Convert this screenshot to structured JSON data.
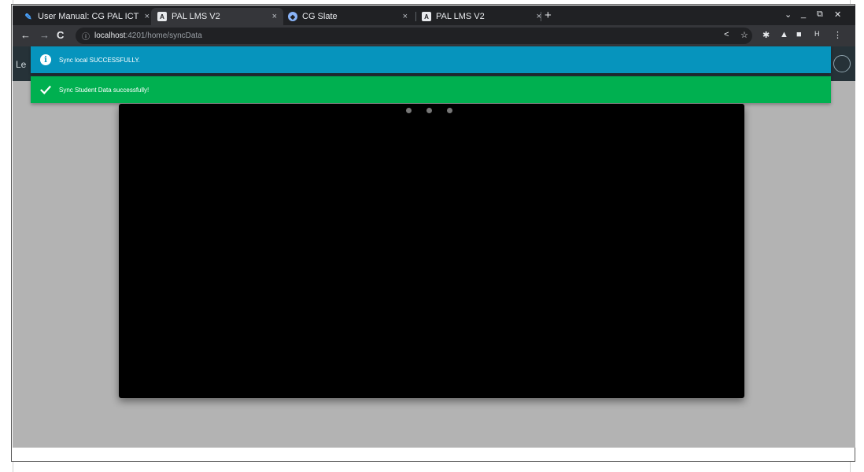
{
  "browser": {
    "tabs": [
      {
        "title": "User Manual: CG PAL ICT",
        "icon": "document-icon",
        "active": false
      },
      {
        "title": "PAL LMS V2",
        "icon": "angular-icon",
        "active": true
      },
      {
        "title": "CG Slate",
        "icon": "shield-icon",
        "active": false
      },
      {
        "title": "PAL LMS V2",
        "icon": "angular-icon",
        "active": false
      }
    ],
    "new_tab": "+",
    "url": {
      "host": "localhost",
      "path": ":4201/home/syncData"
    },
    "profile_initial": "H"
  },
  "app": {
    "brand_partial": "Le"
  },
  "toasts": [
    {
      "type": "info",
      "message": "Sync local SUCCESSFULLY.",
      "color": "#0694bd"
    },
    {
      "type": "success",
      "message": "Sync Student Data successfully!",
      "color": "#00b050"
    }
  ],
  "player": {
    "loading_dots": 3
  }
}
